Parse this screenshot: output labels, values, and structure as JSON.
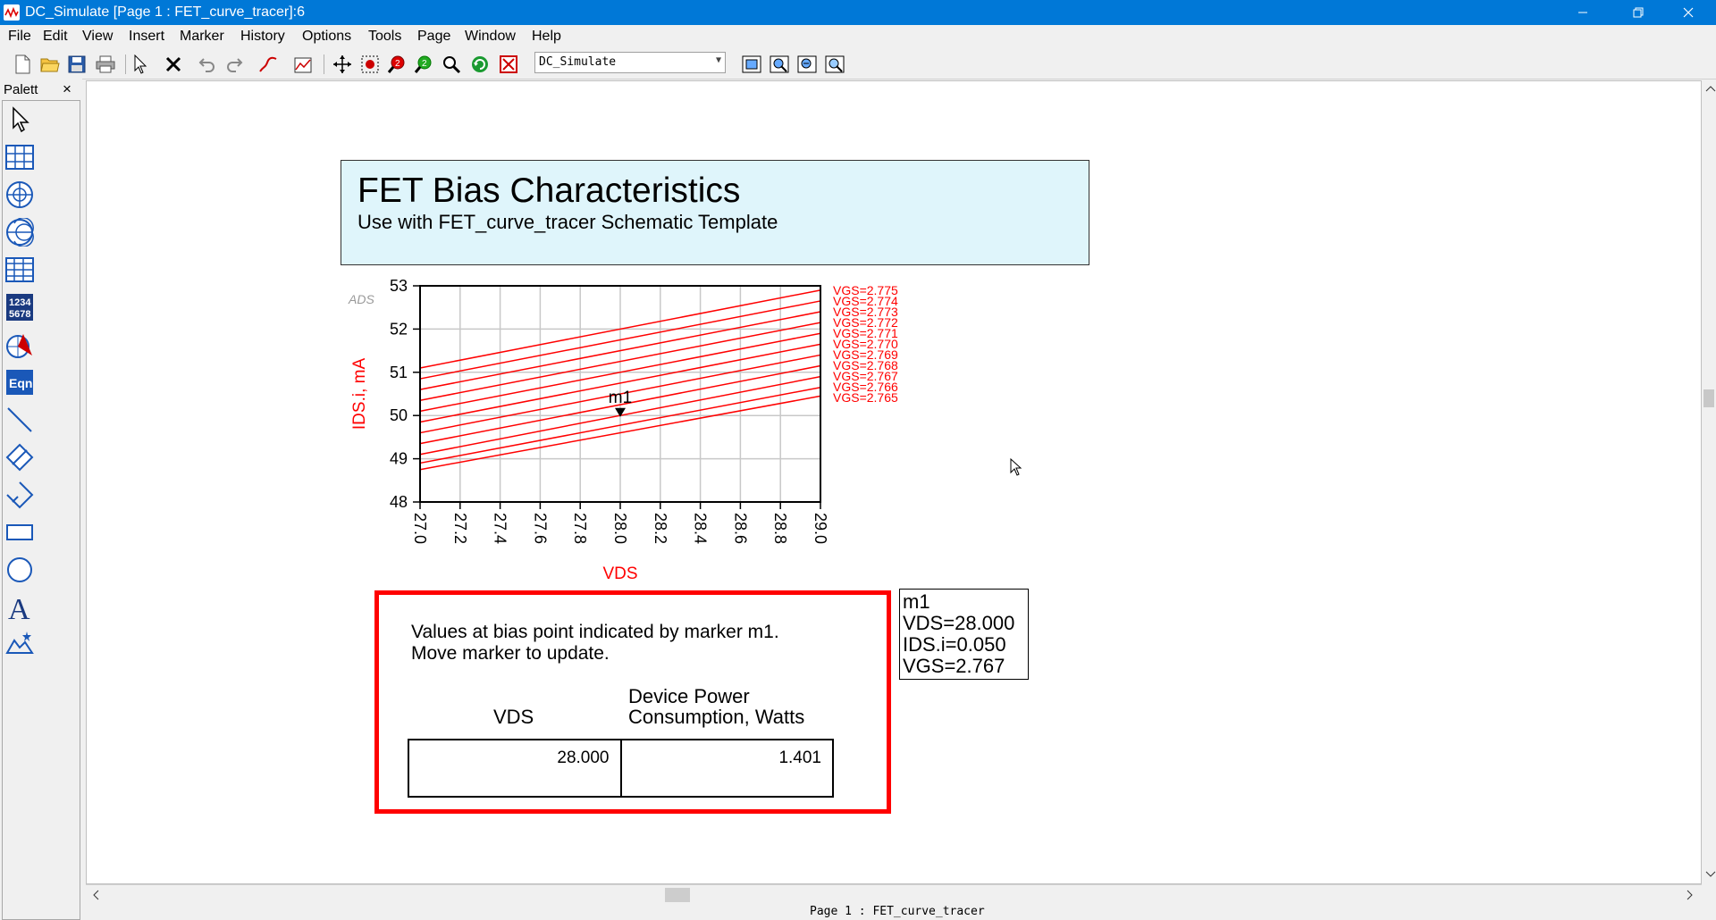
{
  "window": {
    "title": "DC_Simulate [Page 1 : FET_curve_tracer]:6"
  },
  "menu": [
    "File",
    "Edit",
    "View",
    "Insert",
    "Marker",
    "History",
    "Options",
    "Tools",
    "Page",
    "Window",
    "Help"
  ],
  "toolbar": {
    "combo_value": "DC_Simulate"
  },
  "palette": {
    "title": "Palett",
    "close": "×"
  },
  "page": {
    "title": "FET Bias Characteristics",
    "subtitle": "Use with FET_curve_tracer Schematic Template"
  },
  "chart_data": {
    "type": "line",
    "title": "",
    "xlabel": "VDS",
    "ylabel": "IDS.i, mA",
    "corner_label": "ADS",
    "xlim": [
      27.0,
      29.0
    ],
    "ylim": [
      48,
      53
    ],
    "x_ticks": [
      "27.0",
      "27.2",
      "27.4",
      "27.6",
      "27.8",
      "28.0",
      "28.2",
      "28.4",
      "28.6",
      "28.8",
      "29.0"
    ],
    "y_ticks": [
      "48",
      "49",
      "50",
      "51",
      "52",
      "53"
    ],
    "grid": true,
    "x": [
      27.0,
      29.0
    ],
    "series": [
      {
        "name": "VGS=2.775",
        "values": [
          51.1,
          52.9
        ]
      },
      {
        "name": "VGS=2.774",
        "values": [
          50.85,
          52.65
        ]
      },
      {
        "name": "VGS=2.773",
        "values": [
          50.6,
          52.4
        ]
      },
      {
        "name": "VGS=2.772",
        "values": [
          50.35,
          52.15
        ]
      },
      {
        "name": "VGS=2.771",
        "values": [
          50.1,
          51.9
        ]
      },
      {
        "name": "VGS=2.770",
        "values": [
          49.85,
          51.65
        ]
      },
      {
        "name": "VGS=2.769",
        "values": [
          49.6,
          51.4
        ]
      },
      {
        "name": "VGS=2.768",
        "values": [
          49.35,
          51.15
        ]
      },
      {
        "name": "VGS=2.767",
        "values": [
          49.1,
          50.9
        ]
      },
      {
        "name": "VGS=2.766",
        "values": [
          48.9,
          50.65
        ]
      },
      {
        "name": "VGS=2.765",
        "values": [
          48.75,
          50.45
        ]
      }
    ],
    "marker": {
      "label": "m1",
      "x": 28.0,
      "y": 50.05
    }
  },
  "info": {
    "line1": "Values at bias point indicated by marker m1.",
    "line2": "Move marker to update.",
    "col1_header": "VDS",
    "col2_header_line1": "Device Power",
    "col2_header_line2": "Consumption, Watts",
    "col1_value": "28.000",
    "col2_value": "1.401"
  },
  "marker_readout": {
    "name": "m1",
    "vds": "VDS=28.000",
    "ids": "IDS.i=0.050",
    "vgs": "VGS=2.767"
  },
  "statusbar": {
    "text": "Page 1 : FET_curve_tracer"
  }
}
